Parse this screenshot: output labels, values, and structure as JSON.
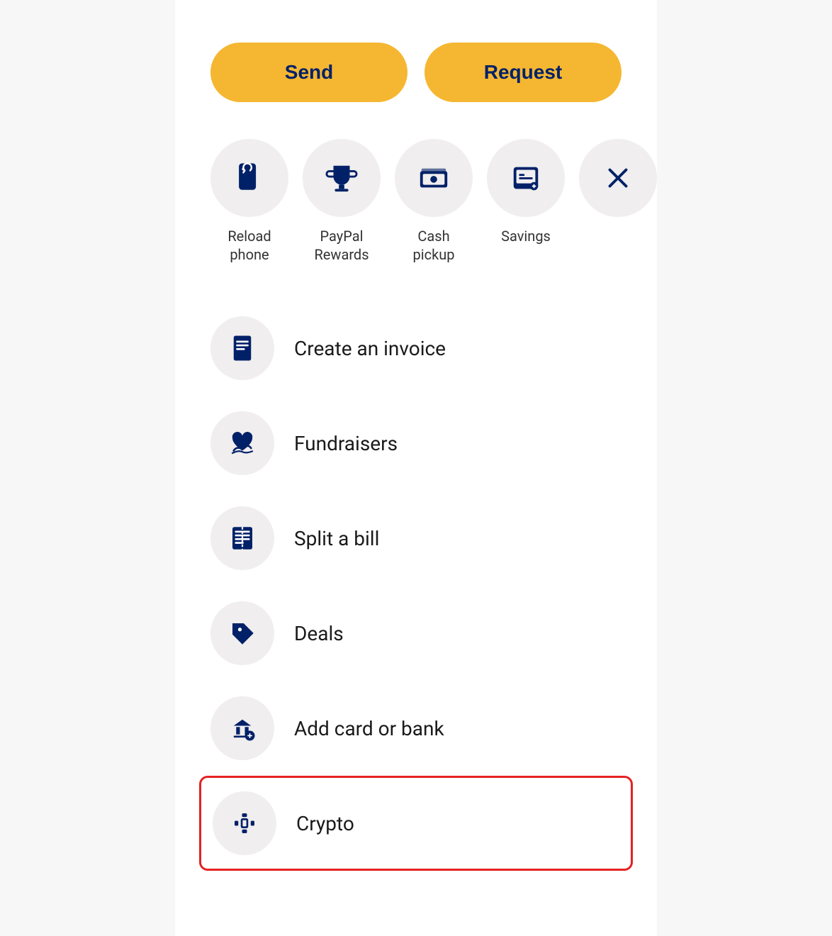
{
  "buttons": {
    "send": "Send",
    "request": "Request"
  },
  "quick_actions": [
    {
      "id": "reload-phone",
      "label": "Reload\nphone",
      "icon": "reload-phone-icon"
    },
    {
      "id": "paypal-rewards",
      "label": "PayPal\nRewards",
      "icon": "trophy-icon"
    },
    {
      "id": "cash-pickup",
      "label": "Cash\npickup",
      "icon": "cash-pickup-icon"
    },
    {
      "id": "savings",
      "label": "Savings",
      "icon": "savings-icon"
    },
    {
      "id": "close",
      "label": "",
      "icon": "close-icon"
    }
  ],
  "list_items": [
    {
      "id": "create-invoice",
      "label": "Create an invoice",
      "icon": "invoice-icon",
      "highlighted": false
    },
    {
      "id": "fundraisers",
      "label": "Fundraisers",
      "icon": "fundraisers-icon",
      "highlighted": false
    },
    {
      "id": "split-bill",
      "label": "Split a bill",
      "icon": "split-bill-icon",
      "highlighted": false
    },
    {
      "id": "deals",
      "label": "Deals",
      "icon": "deals-icon",
      "highlighted": false
    },
    {
      "id": "add-card-bank",
      "label": "Add card or bank",
      "icon": "add-bank-icon",
      "highlighted": false
    },
    {
      "id": "crypto",
      "label": "Crypto",
      "icon": "crypto-icon",
      "highlighted": true
    }
  ]
}
